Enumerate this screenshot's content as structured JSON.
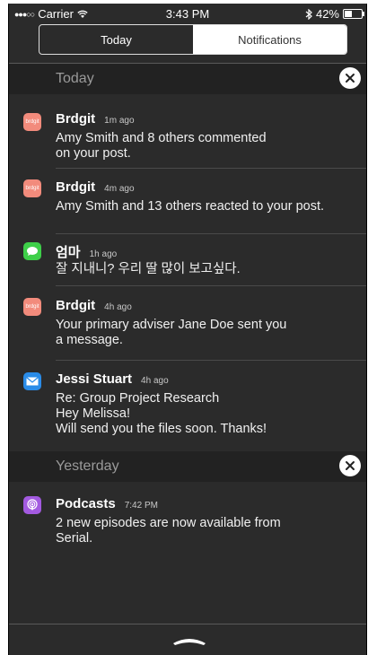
{
  "status_bar": {
    "signal": "●●●○○",
    "carrier": "Carrier",
    "wifi_icon": "wifi-icon",
    "time": "3:43 PM",
    "bluetooth_icon": "bluetooth-icon",
    "battery_percent": "42%",
    "battery_level": 0.42
  },
  "tabs": [
    {
      "label": "Today",
      "selected": false
    },
    {
      "label": "Notifications",
      "selected": true
    }
  ],
  "sections": {
    "today": {
      "title": "Today"
    },
    "yesterday": {
      "title": "Yesterday"
    }
  },
  "notifications": [
    {
      "app": "Brdgit",
      "time": "1m ago",
      "icon": "brdgit-app-icon",
      "icon_text": "brdgit",
      "lines": [
        "Amy Smith and 8 others commented",
        "on your post."
      ]
    },
    {
      "app": "Brdgit",
      "time": "4m ago",
      "icon": "brdgit-app-icon",
      "icon_text": "brdgit",
      "lines": [
        "Amy Smith and 13 others reacted to your post."
      ]
    },
    {
      "app": "엄마",
      "time": "1h ago",
      "icon": "messages-app-icon",
      "lines": [
        "잘 지내니? 우리 딸 많이 보고싶다."
      ]
    },
    {
      "app": "Brdgit",
      "time": "4h ago",
      "icon": "brdgit-app-icon",
      "icon_text": "brdgit",
      "lines": [
        "Your primary adviser Jane Doe sent you",
        "a message."
      ]
    },
    {
      "app": "Jessi Stuart",
      "time": "4h ago",
      "icon": "mail-app-icon",
      "lines": [
        "Re: Group Project Research",
        "Hey Melissa!",
        "Will send you the files soon. Thanks!"
      ]
    },
    {
      "app": "Podcasts",
      "time": "7:42 PM",
      "icon": "podcasts-app-icon",
      "lines": [
        "2 new episodes are now available from",
        "Serial."
      ]
    }
  ],
  "colors": {
    "background": "#2b2b2b",
    "section_header": "#222222",
    "brdgit": "#f28b7c",
    "messages": "#3ecf49",
    "mail": "#2a8ce8",
    "podcasts": "#a35ae0"
  }
}
